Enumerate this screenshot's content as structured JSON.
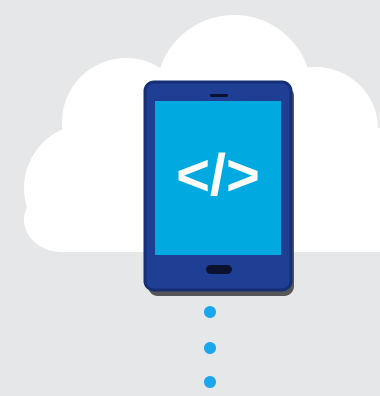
{
  "illustration": {
    "code_symbol_label": "</>",
    "icons": {
      "cloud": "cloud-icon",
      "device": "tablet-icon",
      "code": "code-brackets-icon",
      "connector": "dotted-connector"
    },
    "colors": {
      "background": "#e6e7e8",
      "cloud": "#ffffff",
      "device_body": "#1f3f95",
      "device_border": "#162e73",
      "screen": "#00a9e0",
      "code_symbol": "#ffffff",
      "home_button": "#0b1230",
      "dots": "#1aa7ec",
      "shadow": "#565658"
    }
  }
}
